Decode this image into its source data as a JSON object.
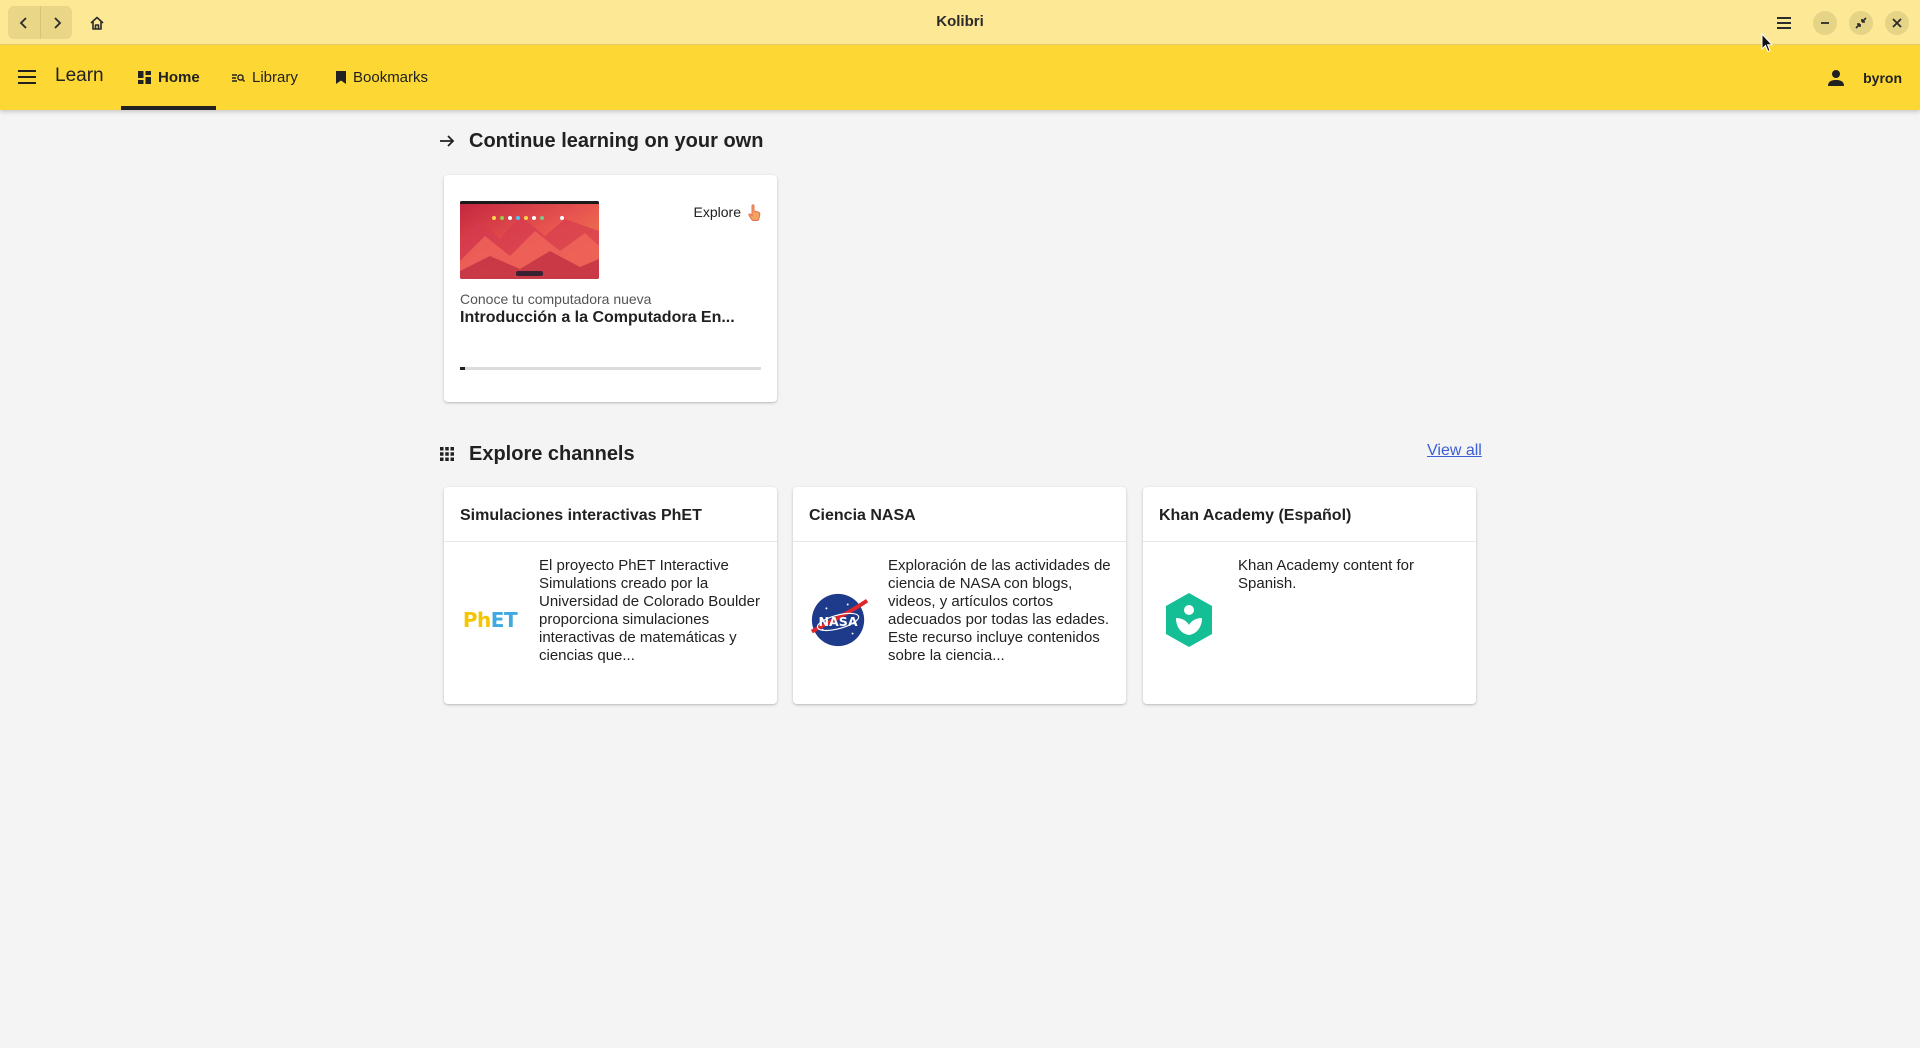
{
  "window": {
    "title": "Kolibri"
  },
  "appbar": {
    "section_label": "Learn",
    "tabs": [
      {
        "label": "Home",
        "icon": "dashboard-icon",
        "active": true
      },
      {
        "label": "Library",
        "icon": "library-icon",
        "active": false
      },
      {
        "label": "Bookmarks",
        "icon": "bookmark-icon",
        "active": false
      }
    ],
    "username": "byron",
    "accent_color": "#fdd835"
  },
  "continue_section": {
    "title": "Continue learning on your own",
    "resume_card": {
      "badge_label": "Explore",
      "subtitle": "Conoce tu computadora nueva",
      "title": "Introducción a la Computadora En...",
      "progress": 0.015
    }
  },
  "channels_section": {
    "title": "Explore channels",
    "view_all_label": "View all",
    "channels": [
      {
        "title": "Simulaciones interactivas PhET",
        "logo_text": "PhET",
        "description": "El proyecto PhET Interactive Simulations creado por la Universidad de Colorado Boulder proporciona simulaciones interactivas de matemáticas y ciencias que..."
      },
      {
        "title": "Ciencia NASA",
        "logo_text": "NASA",
        "description": "Exploración de las actividades de ciencia de NASA con blogs, videos, y artículos cortos adecuados por todas las edades. Este recurso incluye contenidos sobre la ciencia..."
      },
      {
        "title": "Khan Academy (Español)",
        "logo_text": "",
        "description": "Khan Academy content for Spanish."
      }
    ]
  }
}
